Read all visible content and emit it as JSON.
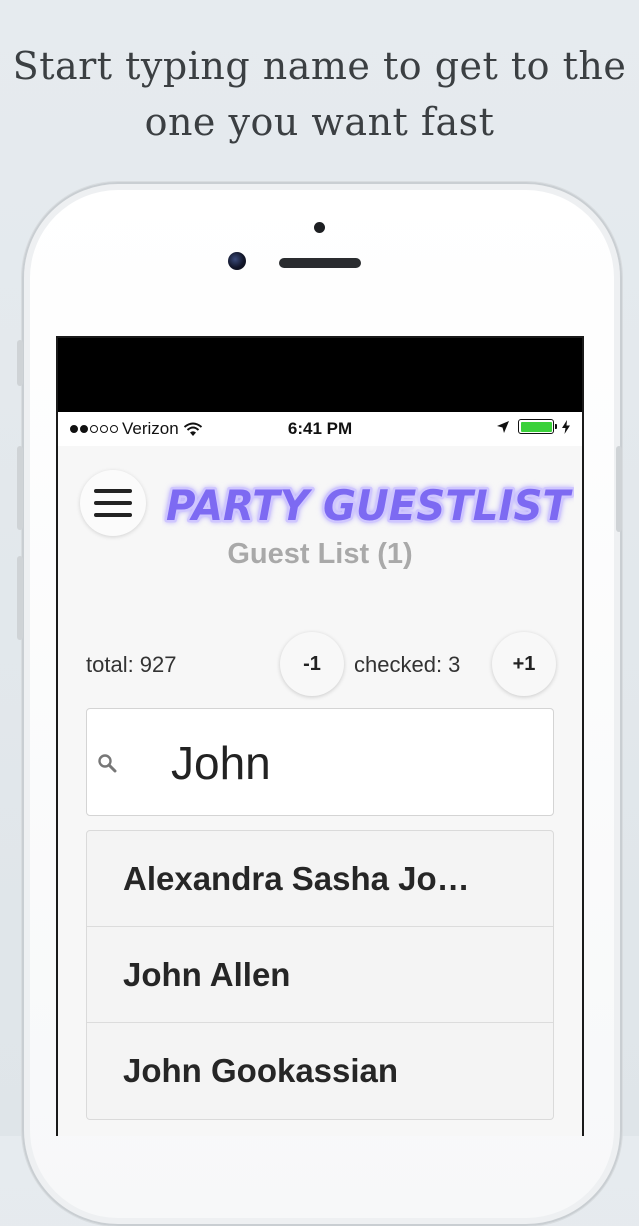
{
  "caption": {
    "line1": "Start typing name to get to the",
    "line2": "one you want fast"
  },
  "status_bar": {
    "carrier": "Verizon",
    "time": "6:41 PM",
    "signal_bars_filled": 2,
    "signal_bars_total": 5,
    "battery_level": 1.0,
    "battery_color": "#3bd13b"
  },
  "header": {
    "menu_icon": "hamburger-icon",
    "logo_text": "PARTY GUESTLIST",
    "logo_colors": {
      "fill": "#7d6bf2",
      "glow": "#cfc6ff"
    }
  },
  "page": {
    "title": "Guest List (1)"
  },
  "counters": {
    "total_label": "total: 927",
    "decrement_label": "-1",
    "checked_label": "checked: 3",
    "increment_label": "+1"
  },
  "search": {
    "icon": "search-icon",
    "value": "John"
  },
  "results": [
    {
      "name": "Alexandra Sasha Jo…"
    },
    {
      "name": "John Allen"
    },
    {
      "name": "John Gookassian"
    }
  ]
}
